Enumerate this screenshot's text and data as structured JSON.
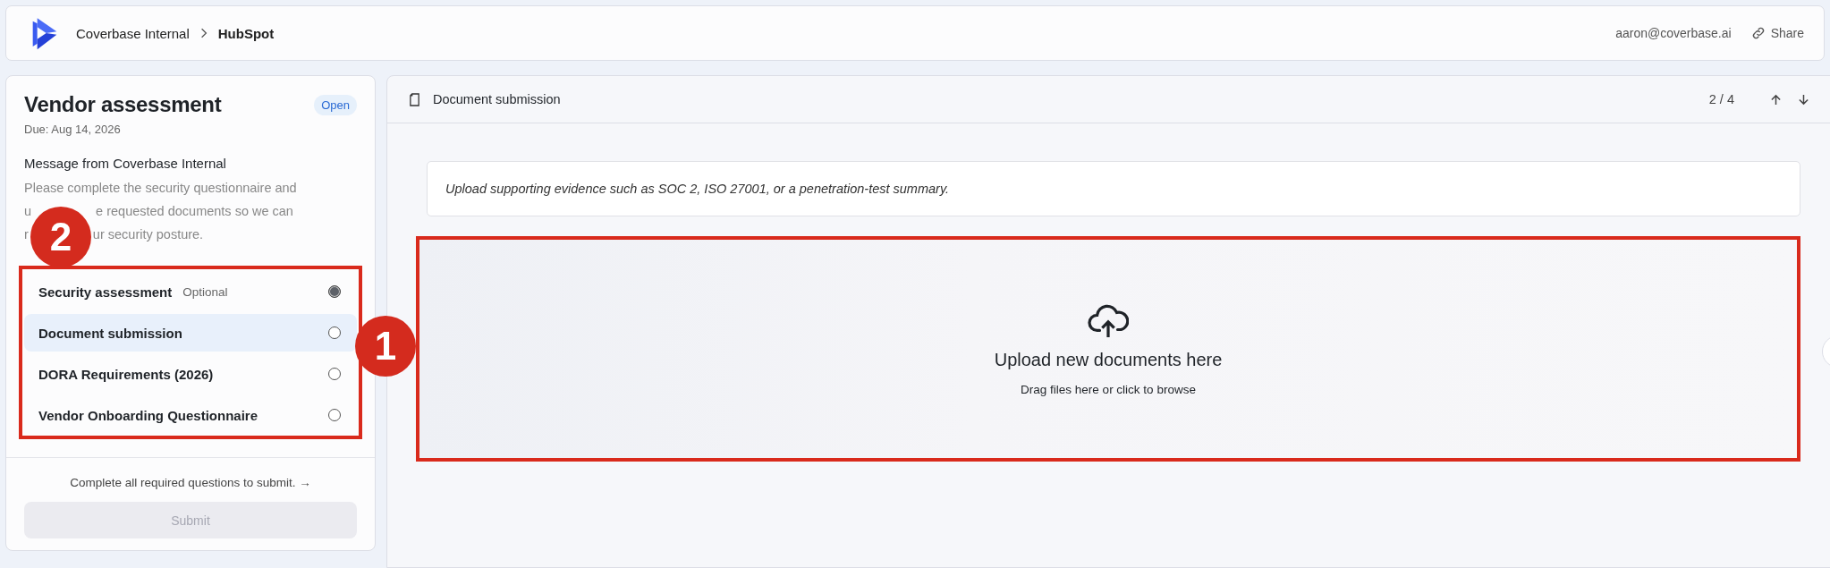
{
  "topbar": {
    "breadcrumb": [
      "Coverbase Internal",
      "HubSpot"
    ],
    "user": "aaron@coverbase.ai",
    "share": "Share"
  },
  "assessment": {
    "title": "Vendor assessment",
    "status": "Open",
    "due": "Due: Aug 14, 2026",
    "message_heading": "Message from Coverbase Internal",
    "message_lines": [
      [
        "Please complete the security questionnaire and"
      ],
      [
        "u",
        "e requested documents so we can"
      ],
      [
        "r",
        "ur security posture."
      ]
    ],
    "sections": [
      {
        "label": "Security assessment",
        "tag": "Optional",
        "selected": false,
        "complete": true
      },
      {
        "label": "Document submission",
        "selected": true,
        "complete": false
      },
      {
        "label": "DORA Requirements (2026)",
        "selected": false,
        "complete": false
      },
      {
        "label": "Vendor Onboarding Questionnaire",
        "selected": false,
        "complete": false
      }
    ],
    "hint": "Complete all required questions to submit. →",
    "submit": {
      "label": "Submit",
      "disabled": true
    }
  },
  "main": {
    "title": "Document submission",
    "position": "2 / 4",
    "instructions": "Upload supporting evidence such as SOC 2, ISO 27001, or a penetration-test summary.",
    "dropzone": {
      "title": "Upload new documents here",
      "subtitle": "Drag files here or click to browse"
    }
  },
  "annotations": [
    {
      "label": "1"
    },
    {
      "label": "2"
    }
  ]
}
